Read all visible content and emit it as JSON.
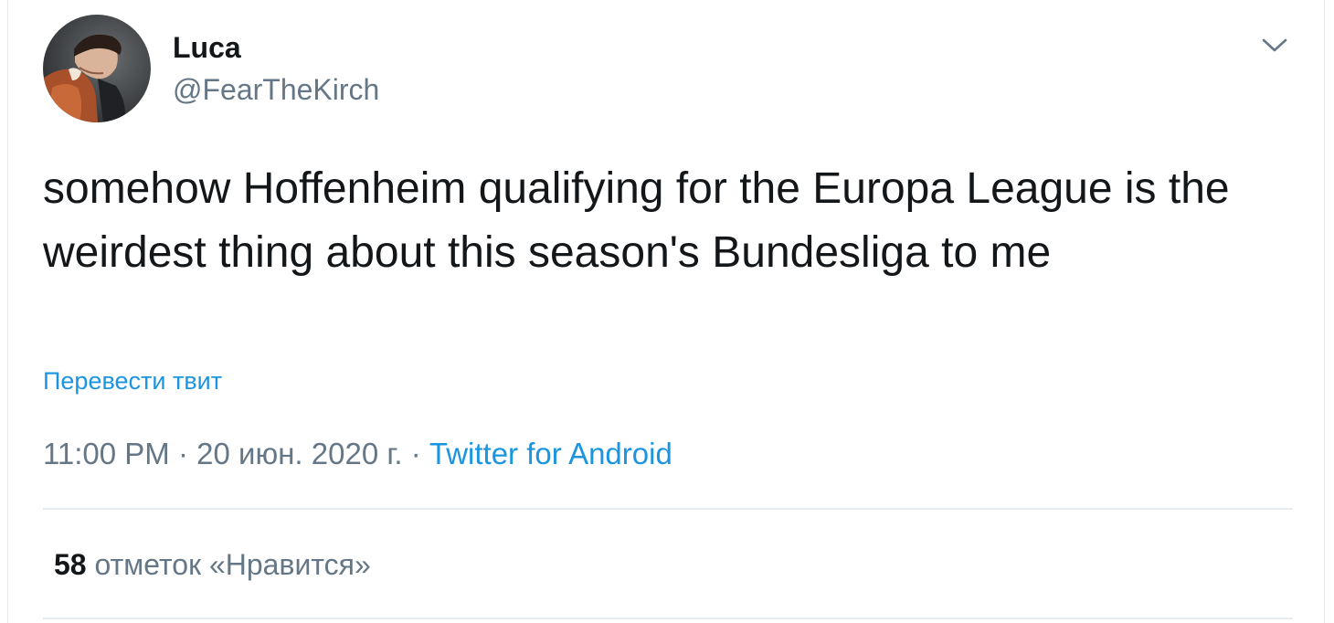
{
  "user": {
    "name": "Luca",
    "handle": "@FearTheKirch"
  },
  "tweet": {
    "text": "somehow Hoffenheim qualifying for the Europa League is the weirdest thing about this season's Bundesliga to me",
    "translate_label": "Перевести твит"
  },
  "meta": {
    "time": "11:00 PM",
    "separator": " · ",
    "date": "20 июн. 2020 г.",
    "source": "Twitter for Android"
  },
  "stats": {
    "likes_count": "58",
    "likes_label": "отметок «Нравится»"
  },
  "icons": {
    "menu": "chevron-down-icon",
    "avatar": "avatar"
  },
  "colors": {
    "link": "#1b95e0",
    "secondary_text": "#657786",
    "primary_text": "#14171a",
    "divider": "#e6ecf0"
  }
}
